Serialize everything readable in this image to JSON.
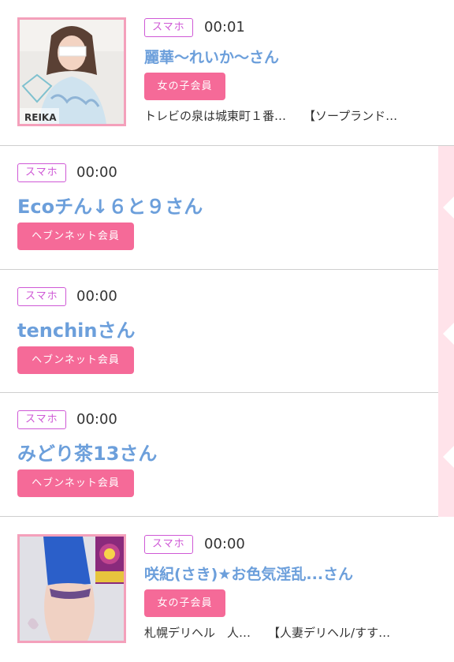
{
  "feed": {
    "items": [
      {
        "device": "スマホ",
        "time": "00:01",
        "name": "麗華〜れいか〜さん",
        "member_type": "女の子会員",
        "desc_1": "トレビの泉は城東町１番…",
        "desc_2": "【ソープランド…",
        "photo_caption": "REIKA"
      },
      {
        "device": "スマホ",
        "time": "00:00",
        "name": "Ecoチん↓６と９さん",
        "member_type": "ヘブンネット会員"
      },
      {
        "device": "スマホ",
        "time": "00:00",
        "name": "tenchinさん",
        "member_type": "ヘブンネット会員"
      },
      {
        "device": "スマホ",
        "time": "00:00",
        "name": "みどり茶13さん",
        "member_type": "ヘブンネット会員"
      },
      {
        "device": "スマホ",
        "time": "00:00",
        "name": "咲紀(さき)★お色気淫乱...さん",
        "member_type": "女の子会員",
        "desc_1": "札幌デリヘル　人…",
        "desc_2": "【人妻デリヘル/すす…"
      }
    ]
  },
  "colors": {
    "device_badge": "#cf59d6",
    "member_badge": "#f56a98",
    "name": "#6c9fdb",
    "photo_border": "#f4a0bb",
    "side_strip": "#ffe3ea"
  }
}
